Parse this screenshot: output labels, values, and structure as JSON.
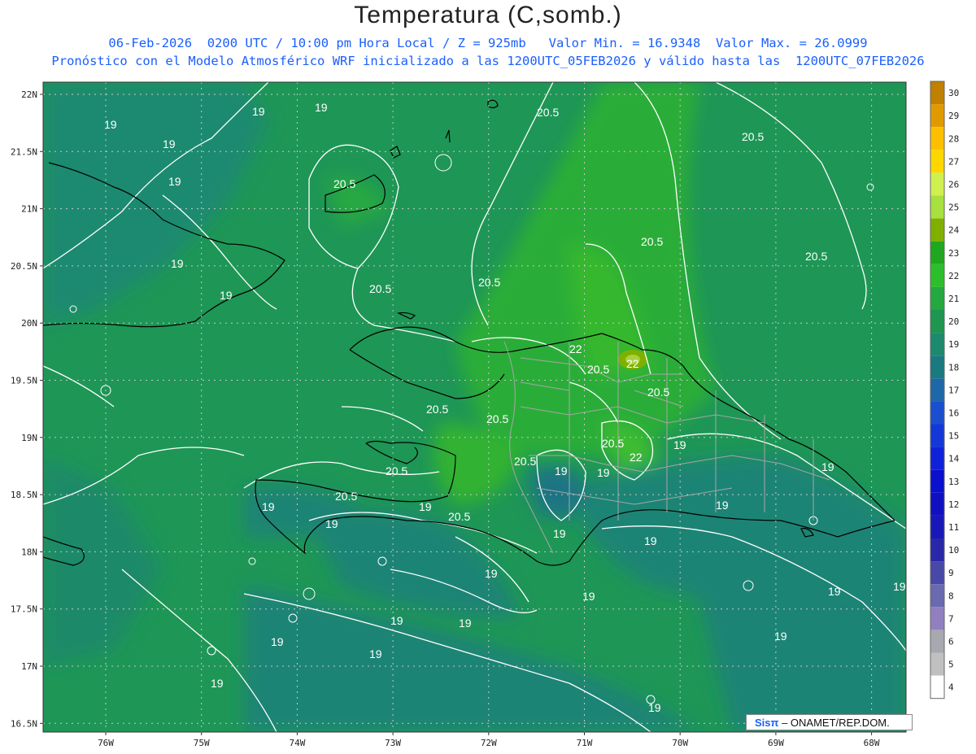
{
  "header": {
    "title": "Temperatura (C,somb.)",
    "line1": "06-Feb-2026  0200 UTC / 10:00 pm Hora Local / Z = 925mb   Valor Min. = 16.9348  Valor Max. = 26.0999",
    "line2": "Pronóstico con el Modelo Atmosférico WRF inicializado a las 1200UTC_05FEB2026 y válido hasta las  1200UTC_07FEB2026"
  },
  "axes": {
    "lat_labels": [
      "22N",
      "21.5N",
      "21N",
      "20.5N",
      "20N",
      "19.5N",
      "19N",
      "18.5N",
      "18N",
      "17.5N",
      "17N",
      "16.5N"
    ],
    "lon_labels": [
      "76W",
      "75W",
      "74W",
      "73W",
      "72W",
      "71W",
      "70W",
      "69W",
      "68W"
    ]
  },
  "colorbar": {
    "levels": [
      "30",
      "29",
      "28",
      "27",
      "26",
      "25",
      "24",
      "23",
      "22",
      "21",
      "20",
      "19",
      "18",
      "17",
      "16",
      "15",
      "14",
      "13",
      "12",
      "11",
      "10",
      "9",
      "8",
      "7",
      "6",
      "5",
      "4"
    ],
    "colors": [
      "#c08000",
      "#e09a00",
      "#ffbf00",
      "#ffd700",
      "#d0f050",
      "#a8e040",
      "#7fb000",
      "#1fa81f",
      "#2cbf2c",
      "#24a840",
      "#1e9650",
      "#1d8a6e",
      "#1a7a80",
      "#1f68a8",
      "#1a4fd0",
      "#1438d8",
      "#0f22d8",
      "#0a10cc",
      "#1010c0",
      "#1818b8",
      "#2828a8",
      "#4848a8",
      "#6a6ab0",
      "#9080c0",
      "#a8a8b0",
      "#c0c0c0",
      "#ffffff"
    ]
  },
  "contour_labels": {
    "low": "19",
    "mid": "20.5",
    "high": "22"
  },
  "credit": {
    "logo": "Sisπ",
    "text": " – ONAMET/REP.DOM."
  }
}
